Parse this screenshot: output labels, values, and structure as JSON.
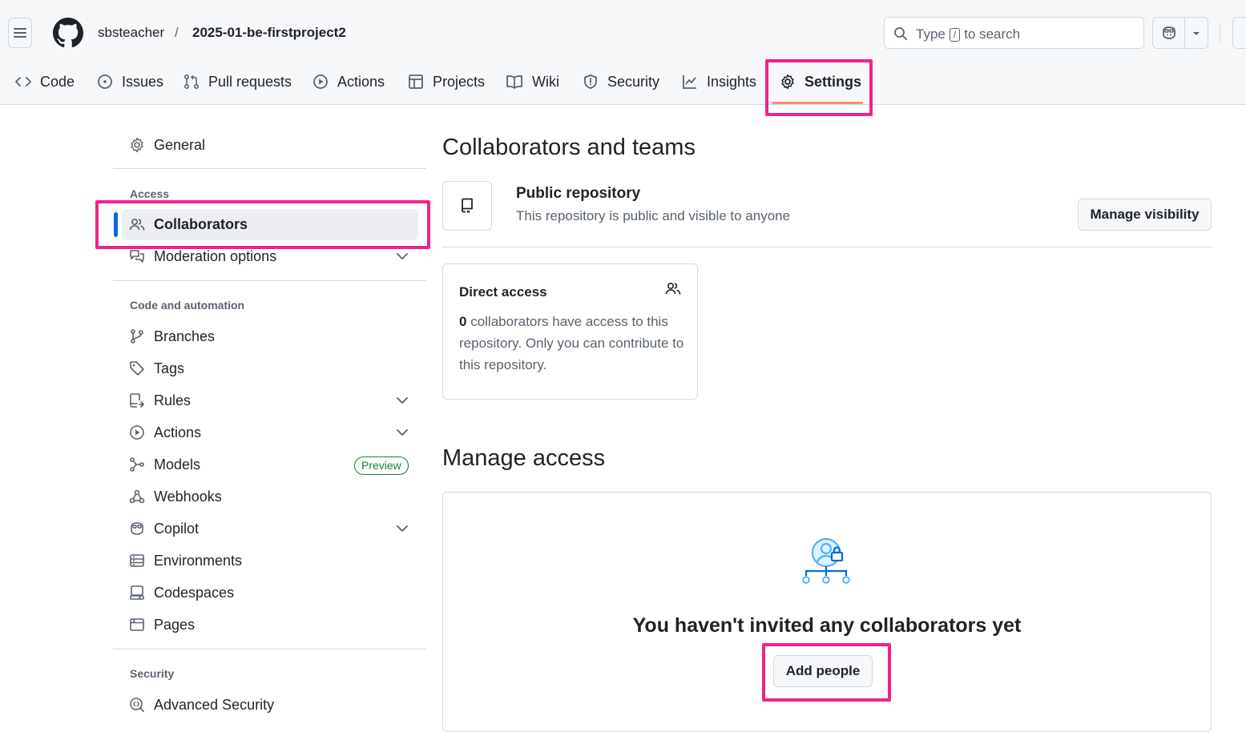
{
  "header": {
    "owner": "sbsteacher",
    "separator": "/",
    "repo": "2025-01-be-firstproject2",
    "search": {
      "prefix": "Type",
      "key": "/",
      "suffix": "to search"
    }
  },
  "tabs": [
    {
      "label": "Code",
      "icon": "code-icon"
    },
    {
      "label": "Issues",
      "icon": "issue-icon"
    },
    {
      "label": "Pull requests",
      "icon": "pull-request-icon"
    },
    {
      "label": "Actions",
      "icon": "play-icon"
    },
    {
      "label": "Projects",
      "icon": "table-icon"
    },
    {
      "label": "Wiki",
      "icon": "book-icon"
    },
    {
      "label": "Security",
      "icon": "shield-icon"
    },
    {
      "label": "Insights",
      "icon": "graph-icon"
    },
    {
      "label": "Settings",
      "icon": "gear-icon",
      "active": true
    }
  ],
  "sidebar": {
    "general": "General",
    "access_heading": "Access",
    "collaborators": "Collaborators",
    "moderation": "Moderation options",
    "code_heading": "Code and automation",
    "branches": "Branches",
    "tags": "Tags",
    "rules": "Rules",
    "actions": "Actions",
    "models": "Models",
    "models_badge": "Preview",
    "webhooks": "Webhooks",
    "copilot": "Copilot",
    "environments": "Environments",
    "codespaces": "Codespaces",
    "pages": "Pages",
    "security_heading": "Security",
    "advanced_security": "Advanced Security"
  },
  "main": {
    "title": "Collaborators and teams",
    "public": {
      "title": "Public repository",
      "desc": "This repository is public and visible to anyone",
      "button": "Manage visibility"
    },
    "direct_access": {
      "title": "Direct access",
      "count": "0",
      "text": "collaborators have access to this repository. Only you can contribute to this repository."
    },
    "manage_title": "Manage access",
    "empty_title": "You haven't invited any collaborators yet",
    "add_button": "Add people"
  },
  "colors": {
    "highlight": "#f0228a",
    "active_tab_underline": "#fd8c73",
    "accent": "#0969da",
    "badge_green": "#1a7f37"
  }
}
